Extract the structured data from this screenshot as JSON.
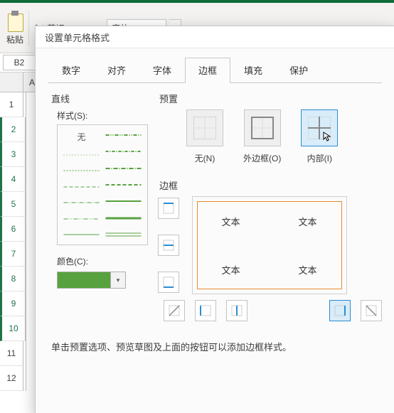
{
  "ribbon": {
    "paste_label": "粘贴",
    "cut_label": "剪切",
    "font_name": "宋体"
  },
  "namebox": "B2",
  "col_header": "A",
  "rows": [
    "1",
    "2",
    "3",
    "4",
    "5",
    "6",
    "7",
    "8",
    "9",
    "10",
    "11",
    "12"
  ],
  "dialog": {
    "title": "设置单元格格式",
    "tabs": [
      "数字",
      "对齐",
      "字体",
      "边框",
      "填充",
      "保护"
    ],
    "active_tab_index": 3,
    "line_section": "直线",
    "style_label": "样式(S):",
    "style_none": "无",
    "color_label": "颜色(C):",
    "color_value": "#57a23e",
    "preset_section": "预置",
    "presets": {
      "none": "无(N)",
      "outline": "外边框(O)",
      "inside": "内部(I)"
    },
    "preset_selected": "inside",
    "border_section": "边框",
    "preview_cell_text": "文本",
    "hint": "单击预置选项、预览草图及上面的按钮可以添加边框样式。"
  }
}
